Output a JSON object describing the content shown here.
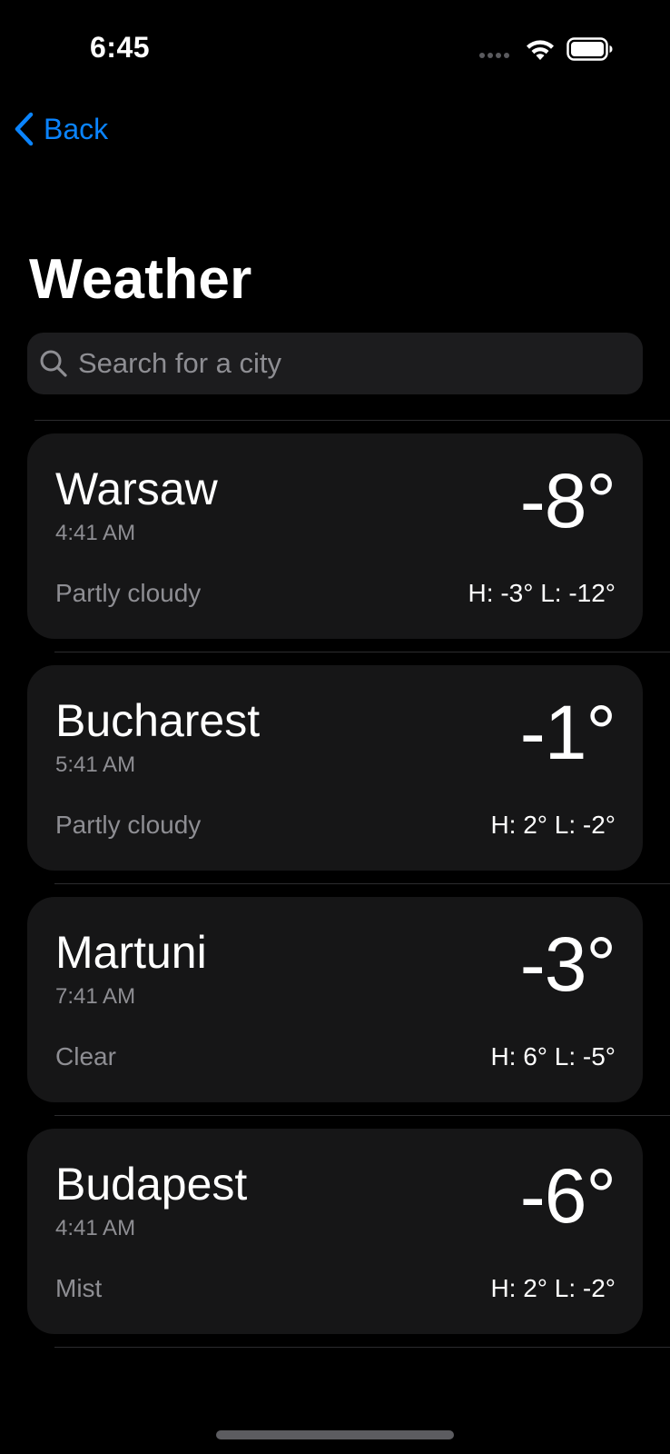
{
  "status_bar": {
    "time": "6:45"
  },
  "nav": {
    "back_label": "Back",
    "title": "Weather"
  },
  "search": {
    "placeholder": "Search for a city",
    "value": ""
  },
  "cities": [
    {
      "name": "Warsaw",
      "local_time": "4:41 AM",
      "temperature": "-8°",
      "condition": "Partly cloudy",
      "high_low": "H: -3° L: -12°"
    },
    {
      "name": "Bucharest",
      "local_time": "5:41 AM",
      "temperature": "-1°",
      "condition": "Partly cloudy",
      "high_low": "H: 2° L: -2°"
    },
    {
      "name": "Martuni",
      "local_time": "7:41 AM",
      "temperature": "-3°",
      "condition": "Clear",
      "high_low": "H: 6° L: -5°"
    },
    {
      "name": "Budapest",
      "local_time": "4:41 AM",
      "temperature": "-6°",
      "condition": "Mist",
      "high_low": "H: 2° L: -2°"
    }
  ],
  "colors": {
    "accent": "#0a84ff",
    "background": "#000000",
    "card": "#161617",
    "secondary_text": "#8e8e93"
  }
}
